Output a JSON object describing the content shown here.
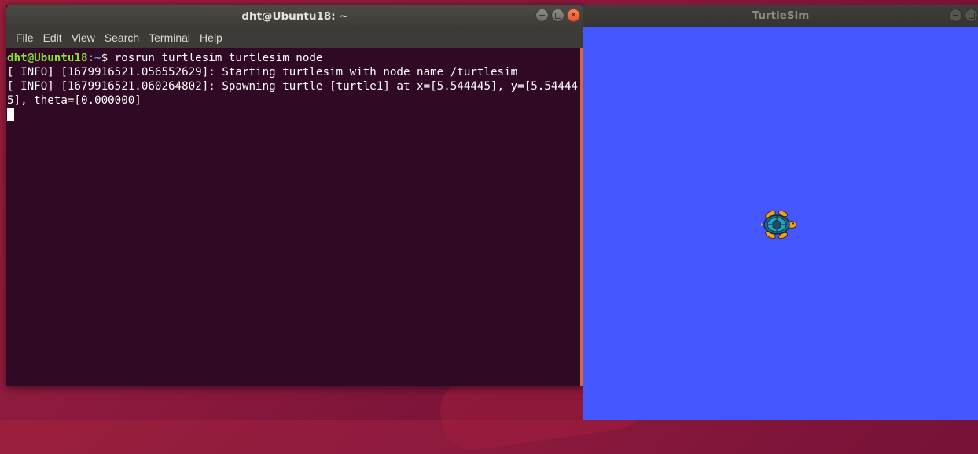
{
  "terminal": {
    "title": "dht@Ubuntu18: ~",
    "menu": [
      "File",
      "Edit",
      "View",
      "Search",
      "Terminal",
      "Help"
    ],
    "prompt_user": "dht@Ubuntu18",
    "prompt_path": ":~",
    "prompt_symbol": "$ ",
    "command": "rosrun turtlesim turtlesim_node",
    "output": [
      "[ INFO] [1679916521.056552629]: Starting turtlesim with node name /turtlesim",
      "[ INFO] [1679916521.060264802]: Spawning turtle [turtle1] at x=[5.544445], y=[5.544445], theta=[0.000000]"
    ]
  },
  "turtlesim": {
    "title": "TurtleSim",
    "background_color": "#4557ff"
  },
  "colors": {
    "terminal_bg": "#300a24",
    "prompt_user": "#8ae234",
    "prompt_path": "#729fcf",
    "accent": "#d8673e"
  }
}
